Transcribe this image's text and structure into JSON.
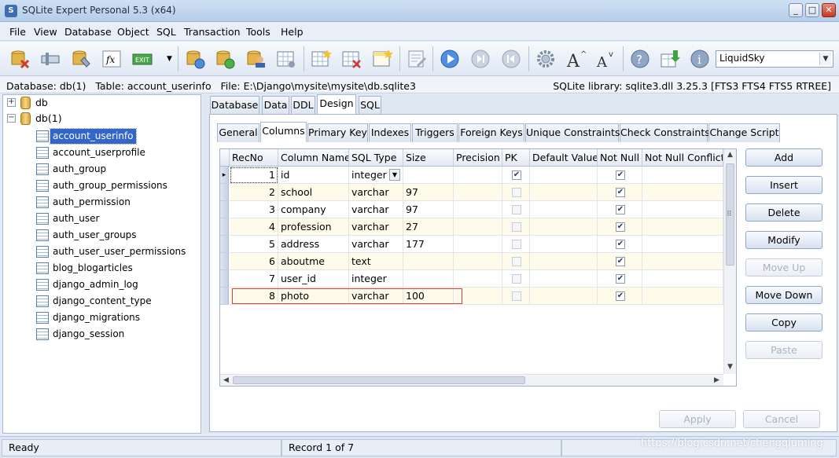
{
  "window": {
    "title": "SQLite Expert Personal 5.3 (x64)",
    "minimize": "_",
    "maximize": "□",
    "close": "✕"
  },
  "menu": [
    "File",
    "View",
    "Database",
    "Object",
    "SQL",
    "Transaction",
    "Tools",
    "Help"
  ],
  "toolbar": {
    "icons": [
      "delete-database-icon",
      "detach-database-icon",
      "database-properties-icon",
      "function-icon",
      "exit-icon",
      "refresh-database-icon",
      "attach-database-icon",
      "user-database-icon",
      "grid-settings-icon",
      "new-table-icon",
      "delete-table-icon",
      "new-view-icon",
      "edit-icon",
      "play-icon",
      "stop-icon",
      "rewind-icon",
      "gear-icon",
      "increase-font-icon",
      "decrease-font-icon",
      "help-icon",
      "download-icon",
      "info-icon"
    ],
    "theme": "LiquidSky"
  },
  "infobar": {
    "left": "Database: db(1)   Table: account_userinfo   File: E:\\Django\\mysite\\mysite\\db.sqlite3",
    "right": "SQLite library: sqlite3.dll 3.25.3 [FTS3 FTS4 FTS5 RTREE]"
  },
  "tree": {
    "databases": [
      {
        "label": "db",
        "expander": "+"
      },
      {
        "label": "db(1)",
        "expander": "−"
      }
    ],
    "tables": [
      "account_userinfo",
      "account_userprofile",
      "auth_group",
      "auth_group_permissions",
      "auth_permission",
      "auth_user",
      "auth_user_groups",
      "auth_user_user_permissions",
      "blog_blogarticles",
      "django_admin_log",
      "django_content_type",
      "django_migrations",
      "django_session"
    ],
    "selected": "account_userinfo"
  },
  "main_tabs": [
    "Database",
    "Data",
    "DDL",
    "Design",
    "SQL"
  ],
  "main_active": "Design",
  "design_tabs": [
    "General",
    "Columns",
    "Primary Key",
    "Indexes",
    "Triggers",
    "Foreign Keys",
    "Unique Constraints",
    "Check Constraints",
    "Change Script"
  ],
  "design_active": "Columns",
  "columns_grid": {
    "headers": [
      "RecNo",
      "Column Name",
      "SQL Type",
      "Size",
      "Precision",
      "PK",
      "Default Value",
      "Not Null",
      "Not Null Conflict"
    ],
    "rows": [
      {
        "recno": "1",
        "name": "id",
        "type": "integer",
        "size": "",
        "pk": true,
        "notnull": true
      },
      {
        "recno": "2",
        "name": "school",
        "type": "varchar",
        "size": "97",
        "pk": false,
        "notnull": true
      },
      {
        "recno": "3",
        "name": "company",
        "type": "varchar",
        "size": "97",
        "pk": false,
        "notnull": true
      },
      {
        "recno": "4",
        "name": "profession",
        "type": "varchar",
        "size": "27",
        "pk": false,
        "notnull": true
      },
      {
        "recno": "5",
        "name": "address",
        "type": "varchar",
        "size": "177",
        "pk": false,
        "notnull": true
      },
      {
        "recno": "6",
        "name": "aboutme",
        "type": "text",
        "size": "",
        "pk": false,
        "notnull": true
      },
      {
        "recno": "7",
        "name": "user_id",
        "type": "integer",
        "size": "",
        "pk": false,
        "notnull": true
      },
      {
        "recno": "8",
        "name": "photo",
        "type": "varchar",
        "size": "100",
        "pk": false,
        "notnull": true
      }
    ],
    "current_row_marker": "▸",
    "highlight_color": "#e0403a"
  },
  "side_buttons": [
    {
      "label": "Add",
      "enabled": true
    },
    {
      "label": "Insert",
      "enabled": true
    },
    {
      "label": "Delete",
      "enabled": true
    },
    {
      "label": "Modify",
      "enabled": true
    },
    {
      "label": "Move Up",
      "enabled": false
    },
    {
      "label": "Move Down",
      "enabled": true
    },
    {
      "label": "Copy",
      "enabled": true
    },
    {
      "label": "Paste",
      "enabled": false
    }
  ],
  "footer_buttons": {
    "apply": "Apply",
    "cancel": "Cancel"
  },
  "status": {
    "left": "Ready",
    "record": "Record 1 of 7",
    "watermark": "https://blog.csdn.net/chengqiuming"
  }
}
